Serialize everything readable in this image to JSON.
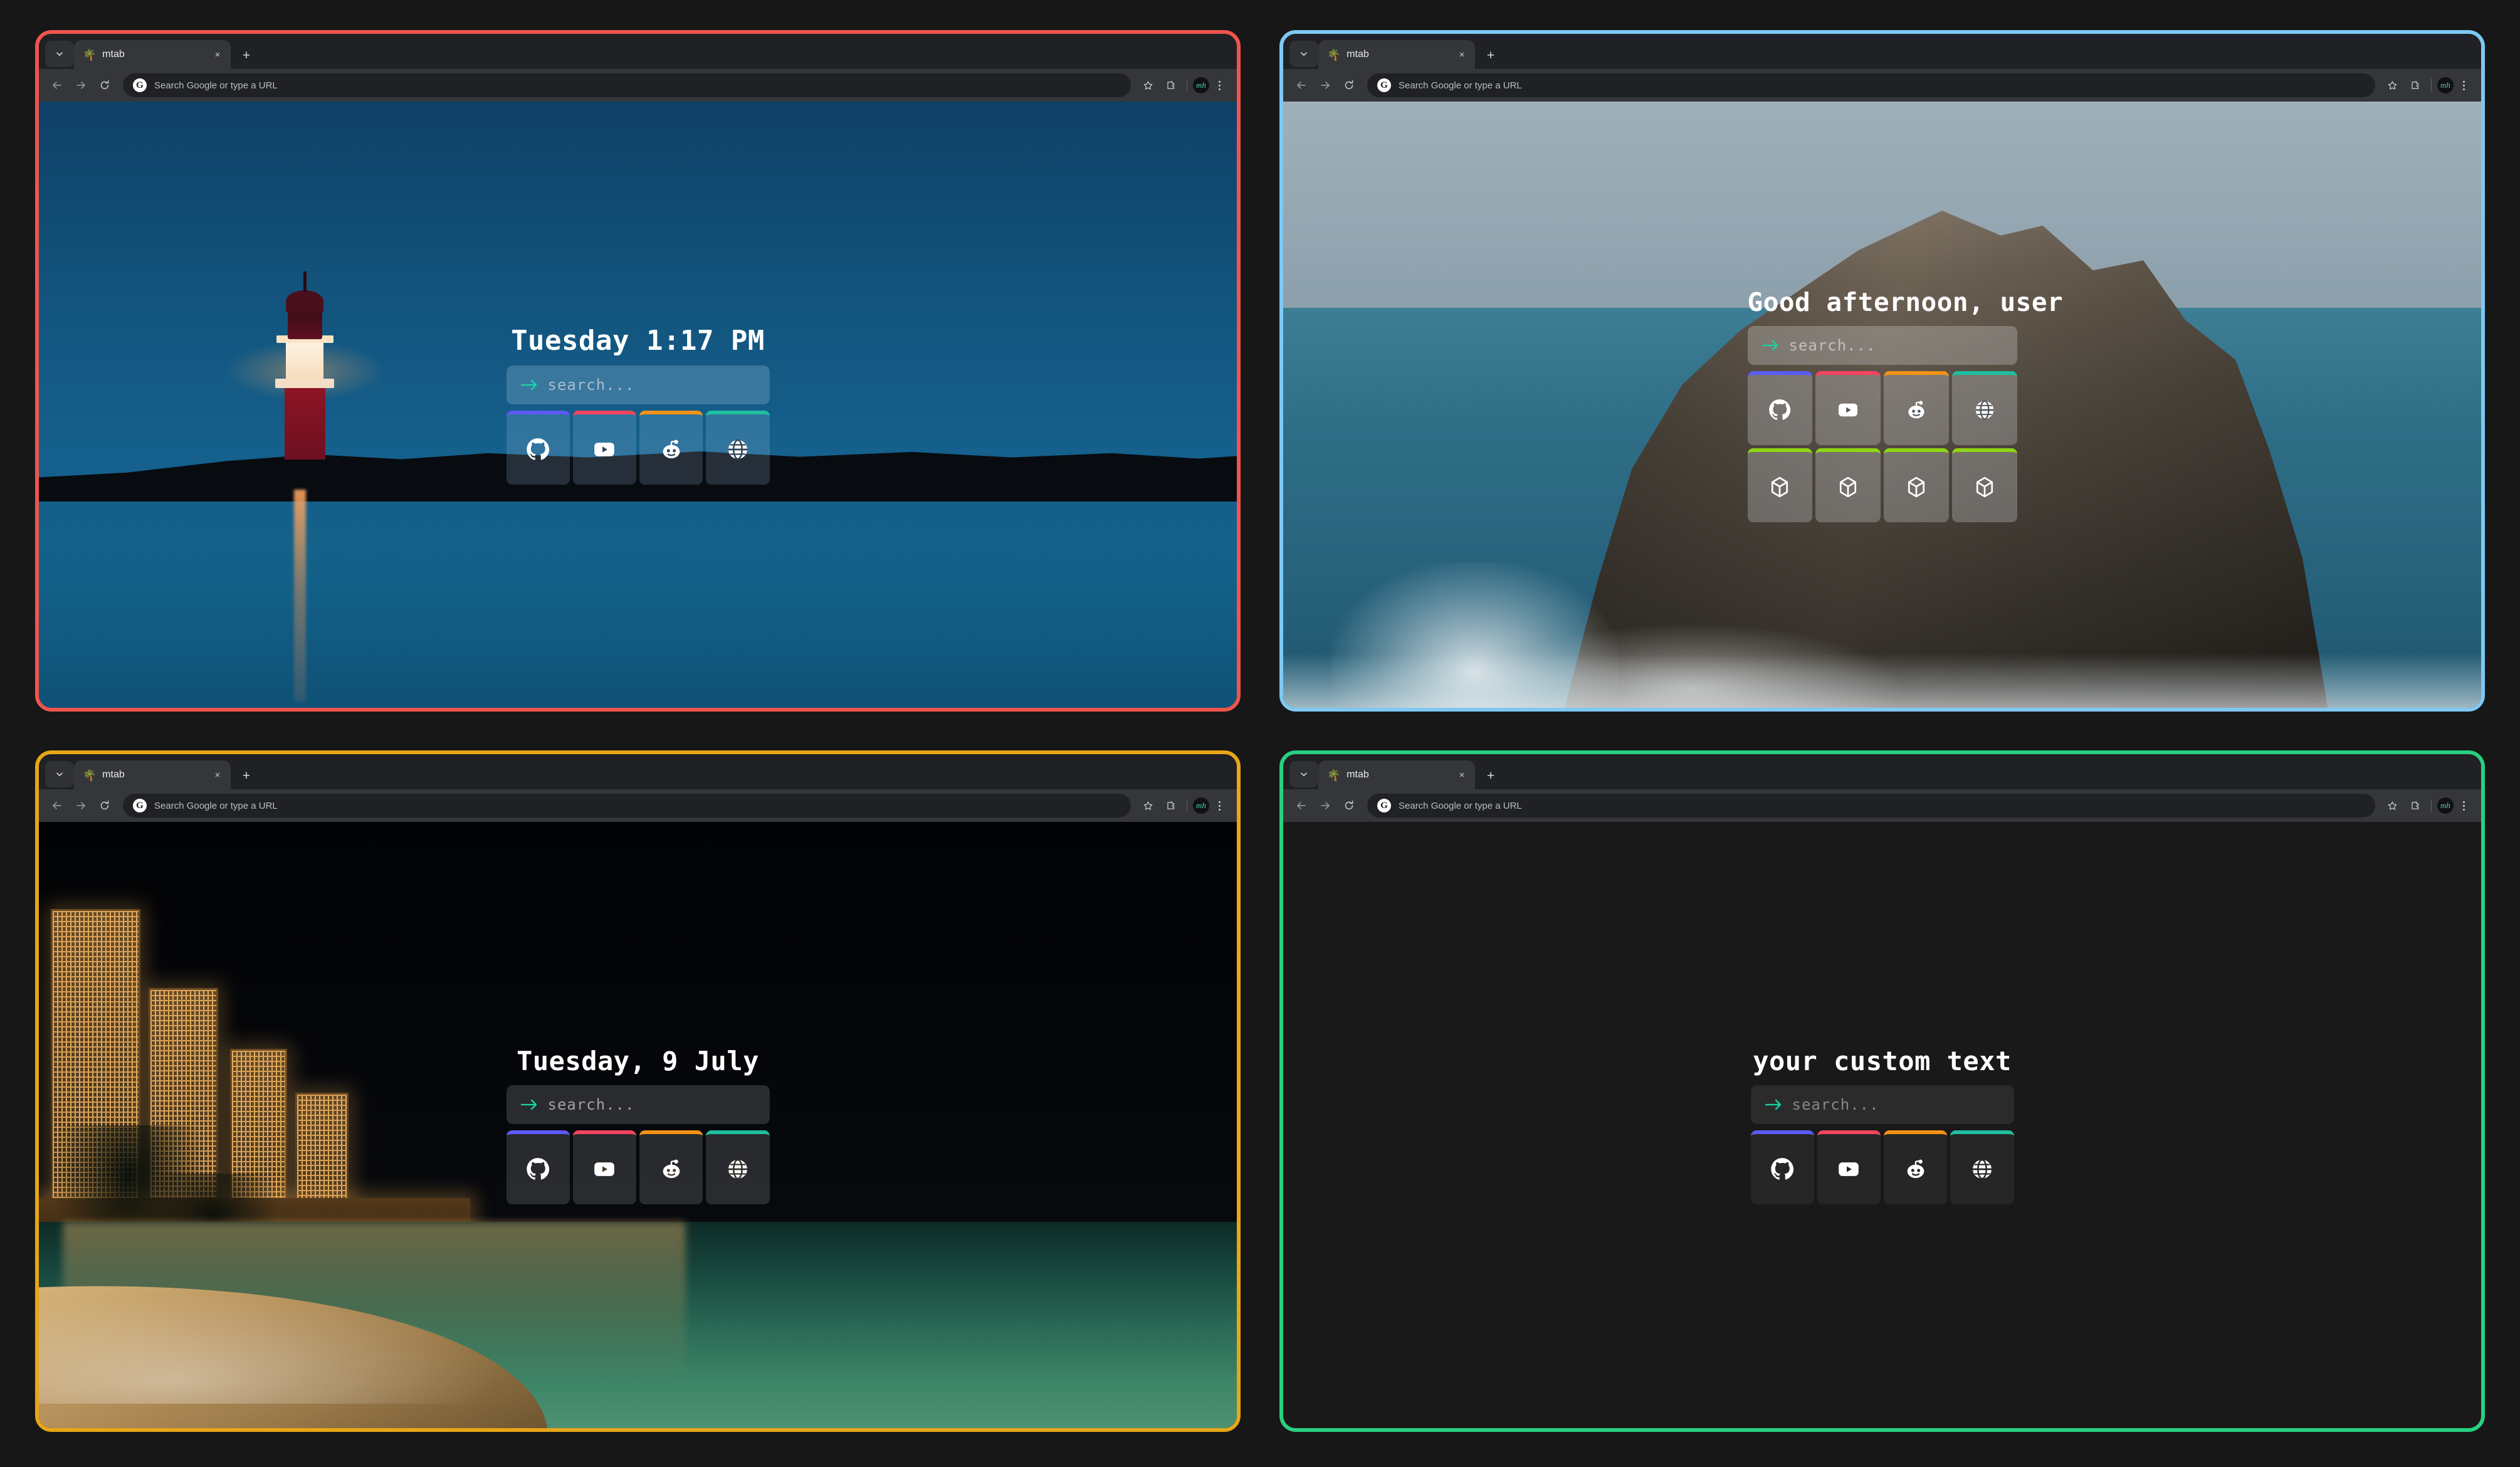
{
  "browser": {
    "tab": {
      "favicon": "🌴",
      "title": "mtab",
      "close_label": "×"
    },
    "new_tab_label": "+",
    "omnibox_placeholder": "Search Google or type a URL",
    "google_logo_letter": "G",
    "avatar_initials": "mh",
    "icons": {
      "tab_list": "chevron-down-icon",
      "back": "back-arrow-icon",
      "forward": "forward-arrow-icon",
      "reload": "reload-icon",
      "bookmark": "star-icon",
      "extensions": "puzzle-icon",
      "menu": "kebab-menu-icon"
    }
  },
  "accents": {
    "window_red": "#f0544d",
    "window_blue": "#7ec8f2",
    "window_yellow": "#e8a617",
    "window_green": "#28d07f",
    "tile_purple": "#5b5bf5",
    "tile_pink": "#f5445f",
    "tile_orange": "#f59215",
    "tile_teal": "#1fbfa0",
    "tile_lime": "#8fd416",
    "search_arrow": "#17d6a8"
  },
  "search": {
    "placeholder": "search...",
    "arrow_icon": "arrow-right-icon"
  },
  "shortcuts": {
    "row1": [
      {
        "name": "github",
        "icon": "github-icon",
        "accent": "#5b5bf5"
      },
      {
        "name": "youtube",
        "icon": "youtube-icon",
        "accent": "#f5445f"
      },
      {
        "name": "reddit",
        "icon": "reddit-icon",
        "accent": "#f59215"
      },
      {
        "name": "web",
        "icon": "globe-icon",
        "accent": "#1fbfa0"
      }
    ],
    "row2": [
      {
        "name": "box-1",
        "icon": "box-icon",
        "accent": "#8fd416"
      },
      {
        "name": "box-2",
        "icon": "box-icon",
        "accent": "#8fd416"
      },
      {
        "name": "box-3",
        "icon": "box-icon",
        "accent": "#8fd416"
      },
      {
        "name": "box-4",
        "icon": "box-icon",
        "accent": "#8fd416"
      }
    ]
  },
  "panels": [
    {
      "id": "panel-clock-time",
      "border_color": "#f0544d",
      "heading": "Tuesday 1:17 PM",
      "background": "lighthouse-blue-hour-photo",
      "rows": 1
    },
    {
      "id": "panel-greeting",
      "border_color": "#7ec8f2",
      "heading": "Good afternoon, user",
      "background": "rocky-sea-stack-photo",
      "rows": 2
    },
    {
      "id": "panel-clock-date",
      "border_color": "#e8a617",
      "heading": "Tuesday, 9 July",
      "background": "night-beach-city-photo",
      "rows": 1
    },
    {
      "id": "panel-custom-text",
      "border_color": "#28d07f",
      "heading": "your custom text",
      "background": "flat-dark",
      "rows": 1
    }
  ]
}
